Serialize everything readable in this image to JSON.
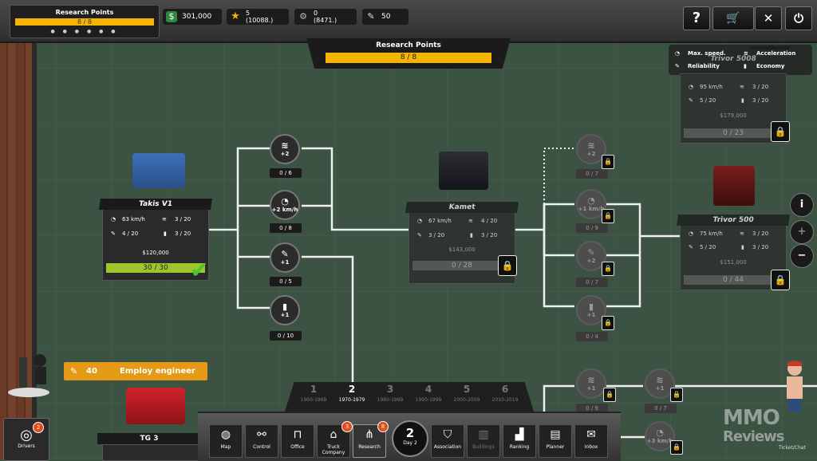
{
  "topbar": {
    "research_points": {
      "label": "Research Points",
      "value": "8 / 8",
      "dots": "● ● ● ● ● ●"
    },
    "money": "301,000",
    "stars": {
      "value": "5",
      "sub": "(10088.)"
    },
    "parts": {
      "value": "0",
      "sub": "(8471.)"
    },
    "engineers": "50",
    "buttons": {
      "help": "?"
    }
  },
  "research_panel": {
    "label": "Research Points",
    "value": "8 / 8"
  },
  "legend": {
    "max_speed": "Max. speed.",
    "acceleration": "Acceleration",
    "reliability": "Reliability",
    "economy": "Economy"
  },
  "trucks": {
    "takis": {
      "name": "Takis V1",
      "speed": "63 km/h",
      "accel": "3 / 20",
      "reliability": "4 / 20",
      "economy": "3 / 20",
      "price": "$120,000",
      "progress": "30 / 30"
    },
    "kamet": {
      "name": "Kamet",
      "speed": "67 km/h",
      "accel": "4 / 20",
      "reliability": "3 / 20",
      "economy": "3 / 20",
      "price": "$143,000",
      "progress": "0 / 28"
    },
    "trivor5008": {
      "name": "Trivor 5008",
      "speed": "95 km/h",
      "accel": "3 / 20",
      "reliability": "5 / 20",
      "economy": "3 / 20",
      "price": "$179,000",
      "progress": "0 / 23"
    },
    "trivor500": {
      "name": "Trivor 500",
      "speed": "75 km/h",
      "accel": "3 / 20",
      "reliability": "5 / 20",
      "economy": "3 / 20",
      "price": "$151,000",
      "progress": "0 / 44"
    },
    "tg3": {
      "name": "TG 3"
    }
  },
  "nodes": {
    "n1": {
      "label": "+2",
      "count": "0 / 6"
    },
    "n2": {
      "label": "+2 km/h",
      "count": "0 / 8"
    },
    "n3": {
      "label": "+1",
      "count": "0 / 5"
    },
    "n4": {
      "label": "+1",
      "count": "0 / 10"
    },
    "k1": {
      "label": "+2",
      "count": "0 / 7"
    },
    "k2": {
      "label": "+1 km/h",
      "count": "0 / 9"
    },
    "k3": {
      "label": "+2",
      "count": "0 / 7"
    },
    "k4": {
      "label": "+1",
      "count": "0 / 4"
    },
    "b1": {
      "label": "+1",
      "count": "0 / 9"
    },
    "b2": {
      "label": "+1",
      "count": "0 / 7"
    },
    "b3": {
      "label": "+3 km/h",
      "count": ""
    }
  },
  "engineer_button": {
    "cost": "40",
    "label": "Employ engineer"
  },
  "timeline": [
    {
      "n": "1",
      "years": "1960-1969"
    },
    {
      "n": "2",
      "years": "1970-1979"
    },
    {
      "n": "3",
      "years": "1980-1989"
    },
    {
      "n": "4",
      "years": "1990-1999"
    },
    {
      "n": "5",
      "years": "2000-2009"
    },
    {
      "n": "6",
      "years": "2010-2019"
    }
  ],
  "bottom_nav": {
    "map": "Map",
    "control": "Control",
    "office": "Office",
    "truck_company": "Truck Company",
    "truck_company_badge": "3",
    "research": "Research",
    "research_badge": "8",
    "day_number": "2",
    "day_label": "Day 2",
    "association": "Association",
    "buildings": "Buildings",
    "ranking": "Ranking",
    "planner": "Planner",
    "inbox": "Inbox"
  },
  "drivers": {
    "label": "Drivers",
    "badge": "2"
  },
  "ticket": "Ticket/Chat",
  "watermark": {
    "line1": "MMO",
    "line2": "Reviews"
  },
  "colors": {
    "accent": "#f4b400",
    "progress_full": "#9cc72a",
    "badge": "#e34b1a",
    "engineer_button": "#e59a17"
  }
}
